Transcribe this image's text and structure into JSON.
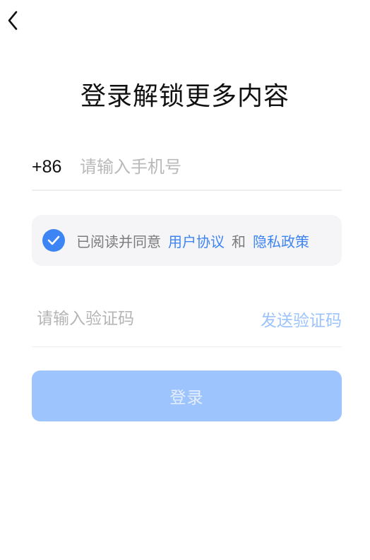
{
  "header": {
    "back_icon": "chevron-left-icon"
  },
  "main": {
    "title": "登录解锁更多内容"
  },
  "phone": {
    "country_code": "+86",
    "placeholder": "请输入手机号",
    "value": ""
  },
  "agreement": {
    "checked": true,
    "check_icon": "checkmark-icon",
    "prefix": "已阅读并同意",
    "user_agreement": "用户协议",
    "conjunction": "和",
    "privacy_policy": "隐私政策"
  },
  "verification": {
    "placeholder": "请输入验证码",
    "value": "",
    "send_label": "发送验证码"
  },
  "login": {
    "label": "登录",
    "enabled": false
  },
  "colors": {
    "accent": "#3d84f5",
    "button_disabled_bg": "#9ec4fd",
    "send_code_disabled": "#9cc3fb"
  }
}
